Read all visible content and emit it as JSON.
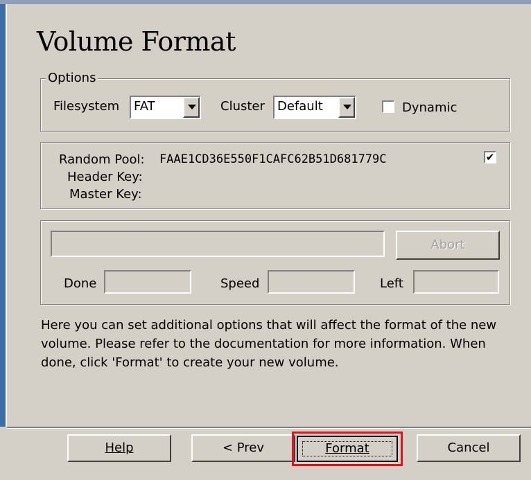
{
  "title": "Volume Format",
  "options": {
    "legend": "Options",
    "filesystem_label": "Filesystem",
    "filesystem_value": "FAT",
    "cluster_label": "Cluster",
    "cluster_value": "Default",
    "dynamic_label": "Dynamic",
    "dynamic_checked": false
  },
  "keys": {
    "random_pool_label": "Random Pool:",
    "random_pool_value": "FAAE1CD36E550F1CAFC62B51D681779C",
    "random_pool_display_checked": true,
    "header_key_label": "Header Key:",
    "master_key_label": "Master Key:"
  },
  "progress": {
    "abort_label": "Abort",
    "done_label": "Done",
    "speed_label": "Speed",
    "left_label": "Left"
  },
  "description": "Here you can set additional options that will affect the format of the new volume. Please refer to the documentation for more information. When done, click 'Format' to create your new volume.",
  "buttons": {
    "help": "Help",
    "prev": "< Prev",
    "format": "Format",
    "cancel": "Cancel"
  },
  "colors": {
    "dialog_bg": "#d4d0c8",
    "highlight_red": "#e0141e"
  }
}
